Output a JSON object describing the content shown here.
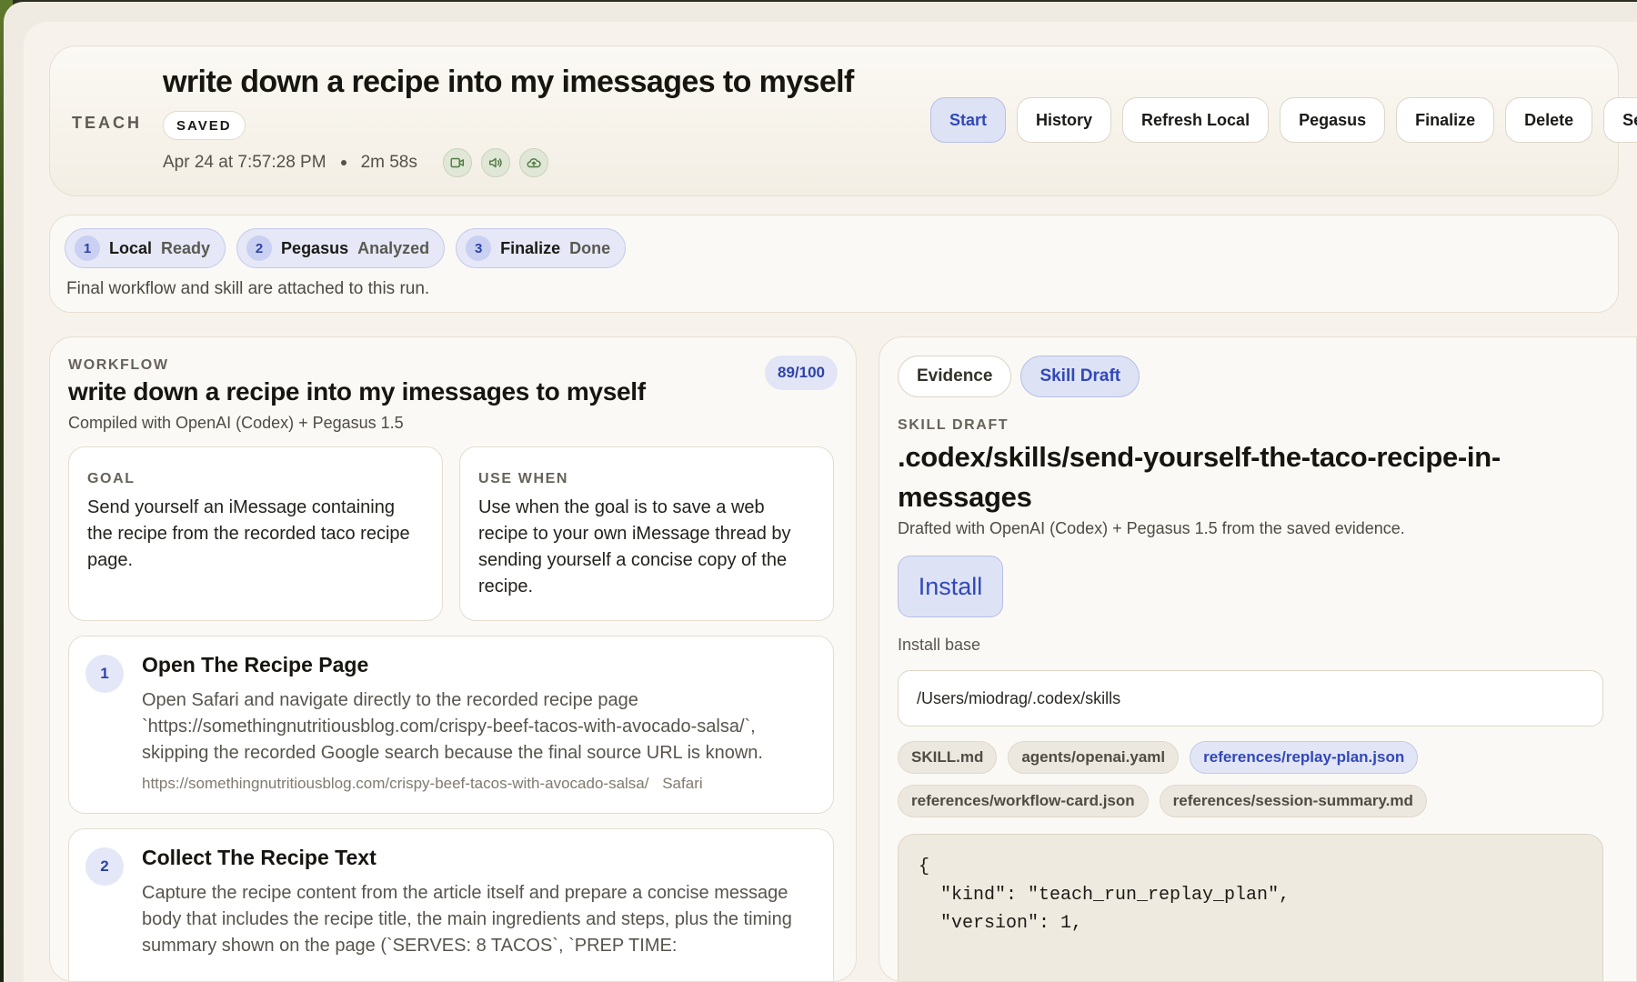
{
  "header": {
    "section_label": "TEACH",
    "title": "write down a recipe into my imessages to myself",
    "status_badge": "SAVED",
    "timestamp": "Apr 24 at 7:57:28 PM",
    "duration": "2m 58s",
    "media_icons": [
      "video-icon",
      "audio-icon",
      "upload-cloud-icon"
    ],
    "toolbar": {
      "start": "Start",
      "history": "History",
      "refresh_local": "Refresh Local",
      "pegasus": "Pegasus",
      "finalize": "Finalize",
      "delete": "Delete",
      "setup": "Setup"
    }
  },
  "pipeline": {
    "stages": [
      {
        "num": "1",
        "name": "Local",
        "status": "Ready"
      },
      {
        "num": "2",
        "name": "Pegasus",
        "status": "Analyzed"
      },
      {
        "num": "3",
        "name": "Finalize",
        "status": "Done"
      }
    ],
    "note": "Final workflow and skill are attached to this run."
  },
  "workflow": {
    "label": "WORKFLOW",
    "title": "write down a recipe into my imessages to myself",
    "subtitle": "Compiled with OpenAI (Codex) + Pegasus 1.5",
    "score": "89/100",
    "goal": {
      "label": "GOAL",
      "text": "Send yourself an iMessage containing the recipe from the recorded taco recipe page."
    },
    "use_when": {
      "label": "USE WHEN",
      "text": "Use when the goal is to save a web recipe to your own iMessage thread by sending yourself a concise copy of the recipe."
    },
    "steps": [
      {
        "num": "1",
        "title": "Open The Recipe Page",
        "body": "Open Safari and navigate directly to the recorded recipe page `https://somethingnutritiousblog.com/crispy-beef-tacos-with-avocado-salsa/`, skipping the recorded Google search because the final source URL is known.",
        "url": "https://somethingnutritiousblog.com/crispy-beef-tacos-with-avocado-salsa/",
        "app": "Safari"
      },
      {
        "num": "2",
        "title": "Collect The Recipe Text",
        "body": "Capture the recipe content from the article itself and prepare a concise message body that includes the recipe title, the main ingredients and steps, plus the timing summary shown on the page (`SERVES: 8 TACOS`, `PREP TIME:"
      }
    ]
  },
  "skill": {
    "tabs": {
      "evidence": "Evidence",
      "skill_draft": "Skill Draft"
    },
    "label": "SKILL DRAFT",
    "title": ".codex/skills/send-yourself-the-taco-recipe-in-messages",
    "subtitle": "Drafted with OpenAI (Codex) + Pegasus 1.5 from the saved evidence.",
    "install_label": "Install",
    "install_base_label": "Install base",
    "install_base_value": "/Users/miodrag/.codex/skills",
    "files": [
      "SKILL.md",
      "agents/openai.yaml",
      "references/replay-plan.json",
      "references/workflow-card.json",
      "references/session-summary.md"
    ],
    "active_file": "references/replay-plan.json",
    "code": "{\n  \"kind\": \"teach_run_replay_plan\",\n  \"version\": 1,"
  },
  "colors": {
    "accent": "#3148b7",
    "accent_bg": "#dde2f5",
    "panel_bg": "#f7f3ec",
    "icon_green_bg": "#e1e7d6"
  }
}
